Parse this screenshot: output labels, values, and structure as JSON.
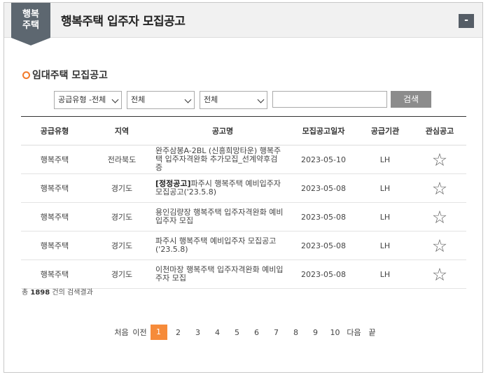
{
  "header": {
    "badge_line1": "행복",
    "badge_line2": "주택",
    "title": "행복주택 입주자 모집공고",
    "collapse_label": "-"
  },
  "section": {
    "title": "임대주택 모집공고"
  },
  "filters": {
    "supply_type": "공급유형 -전체",
    "region": "전체",
    "district": "전체",
    "search_value": "",
    "search_button": "검색"
  },
  "table": {
    "headers": [
      "공급유형",
      "지역",
      "공고명",
      "모집공고일자",
      "공급기관",
      "관심공고"
    ],
    "rows": [
      {
        "type": "행복주택",
        "region": "전라북도",
        "tag": "",
        "title": "완주삼봉A-2BL (신흥희망타운) 행복주택 입주자격완화 추가모집_선계약후검증",
        "date": "2023-05-10",
        "agency": "LH"
      },
      {
        "type": "행복주택",
        "region": "경기도",
        "tag": "[정정공고]",
        "title": "파주시 행복주택 예비입주자 모집공고('23.5.8)",
        "date": "2023-05-08",
        "agency": "LH"
      },
      {
        "type": "행복주택",
        "region": "경기도",
        "tag": "",
        "title": "용인김량장 행복주택 입주자격완화 예비입주자 모집",
        "date": "2023-05-08",
        "agency": "LH"
      },
      {
        "type": "행복주택",
        "region": "경기도",
        "tag": "",
        "title": "파주시 행복주택 예비입주자 모집공고('23.5.8)",
        "date": "2023-05-08",
        "agency": "LH"
      },
      {
        "type": "행복주택",
        "region": "경기도",
        "tag": "",
        "title": "이천마장 행복주택 입주자격완화 예비입주자 모집",
        "date": "2023-05-08",
        "agency": "LH"
      }
    ]
  },
  "result": {
    "prefix": "총",
    "count": "1898",
    "suffix": "건의 검색결과"
  },
  "pagination": {
    "first": "처음",
    "prev": "이전",
    "pages": [
      "1",
      "2",
      "3",
      "4",
      "5",
      "6",
      "7",
      "8",
      "9",
      "10"
    ],
    "current": "1",
    "next": "다음",
    "last": "끝"
  },
  "icons": {
    "star": "star-outline-icon",
    "bullet": "ring-bullet-icon"
  },
  "colors": {
    "accent": "#f68b3a",
    "badge": "#5d6770",
    "button": "#8c8c8c"
  }
}
